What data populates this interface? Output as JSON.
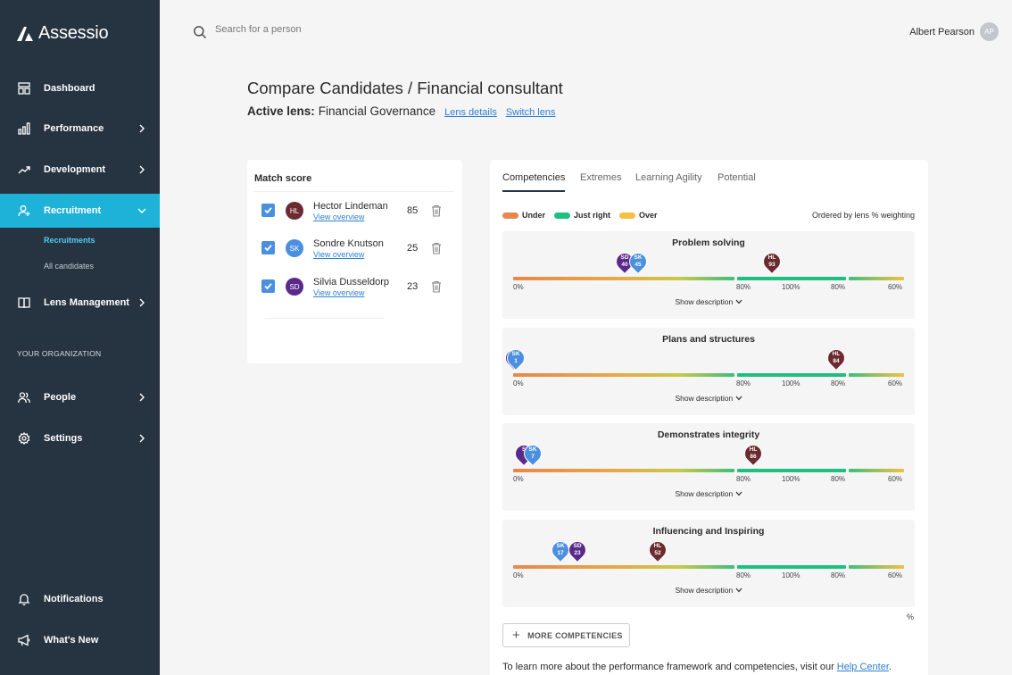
{
  "app": {
    "brand": "Assessio"
  },
  "search": {
    "placeholder": "Search for a person"
  },
  "user": {
    "name": "Albert Pearson",
    "initials": "AP"
  },
  "sidebar": {
    "items": [
      {
        "label": "Dashboard",
        "icon": "dashboard-icon"
      },
      {
        "label": "Performance",
        "icon": "bar-chart-icon"
      },
      {
        "label": "Development",
        "icon": "trending-up-icon"
      },
      {
        "label": "Recruitment",
        "icon": "add-user-icon",
        "active": true
      },
      {
        "label": "Lens Management",
        "icon": "book-icon"
      },
      {
        "label": "People",
        "icon": "people-icon"
      },
      {
        "label": "Settings",
        "icon": "gear-icon"
      },
      {
        "label": "Notifications",
        "icon": "bell-icon"
      },
      {
        "label": "What's New",
        "icon": "megaphone-icon"
      }
    ],
    "sub_items": [
      {
        "label": "Recruitments",
        "active": true
      },
      {
        "label": "All candidates"
      }
    ],
    "section_label": "YOUR ORGANIZATION"
  },
  "header": {
    "title": "Compare Candidates / Financial consultant",
    "lens_label": "Active lens:",
    "lens_name": "Financial Governance",
    "lens_details": "Lens details",
    "switch_lens": "Switch lens"
  },
  "match": {
    "title": "Match score",
    "link_label": "View overview",
    "candidates": [
      {
        "name": "Hector Lindeman",
        "initials": "HL",
        "score": "85",
        "color": "#6b2b30"
      },
      {
        "name": "Sondre Knutson",
        "initials": "SK",
        "score": "25",
        "color": "#4b8fe0"
      },
      {
        "name": "Silvia Dusseldorp",
        "initials": "SD",
        "score": "23",
        "color": "#5a2a8a"
      }
    ]
  },
  "tabs": [
    "Competencies",
    "Extremes",
    "Learning Agility",
    "Potential"
  ],
  "legend": {
    "under": "Under",
    "just_right": "Just right",
    "over": "Over",
    "ordered": "Ordered by lens % weighting"
  },
  "colors": {
    "under": "#e9874a",
    "just_right": "#1fbf83",
    "over": "#f3c041",
    "accent": "#1fb2d9",
    "sidebar": "#263340"
  },
  "ticks": [
    "0%",
    "80%",
    "100%",
    "80%",
    "60%"
  ],
  "show_description": "Show description",
  "competencies": [
    {
      "title": "Problem solving",
      "pins": [
        {
          "i": "SD",
          "v": "40"
        },
        {
          "i": "SK",
          "v": "45"
        },
        {
          "i": "HL",
          "v": "93"
        }
      ]
    },
    {
      "title": "Plans and structures",
      "pins": [
        {
          "i": "SD",
          "v": ""
        },
        {
          "i": "SK",
          "v": "1"
        },
        {
          "i": "HL",
          "v": "84"
        }
      ]
    },
    {
      "title": "Demonstrates integrity",
      "pins": [
        {
          "i": "S",
          "v": ""
        },
        {
          "i": "SK",
          "v": "7"
        },
        {
          "i": "HL",
          "v": "86"
        }
      ]
    },
    {
      "title": "Influencing and Inspiring",
      "pins": [
        {
          "i": "SK",
          "v": "17"
        },
        {
          "i": "SD",
          "v": "23"
        },
        {
          "i": "HL",
          "v": "52"
        }
      ]
    }
  ],
  "percent_symbol": "%",
  "more_button": "MORE COMPETENCIES",
  "help": {
    "text": "To learn more about the performance framework and competencies, visit our ",
    "link": "Help Center",
    "suffix": "."
  }
}
